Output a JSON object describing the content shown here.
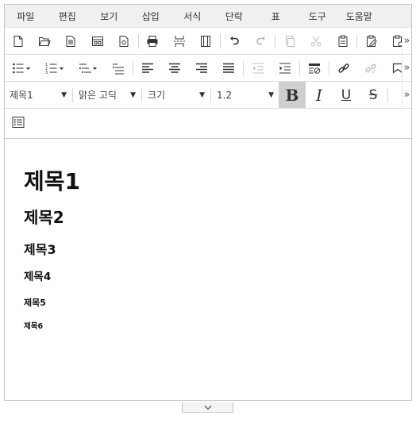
{
  "menubar": {
    "items": [
      "파일",
      "편집",
      "보기",
      "삽입",
      "서식",
      "단락",
      "표",
      "도구",
      "도움말"
    ]
  },
  "toolbar1": {
    "icons": [
      "new-document-icon",
      "open-folder-icon",
      "document-icon",
      "template-icon",
      "document-settings-icon",
      "print-icon",
      "page-break-icon",
      "fit-page-icon",
      "undo-icon",
      "redo-icon",
      "copy-icon",
      "cut-icon",
      "paste-icon",
      "paste-format-icon",
      "paste-special-icon"
    ],
    "more": "»"
  },
  "toolbar2": {
    "icons": [
      "bullet-list-icon",
      "numbered-list-icon",
      "multilevel-list-icon",
      "outline-list-icon",
      "align-left-icon",
      "align-center-icon",
      "align-right-icon",
      "align-justify-icon",
      "decrease-indent-icon",
      "increase-indent-icon",
      "clear-format-icon",
      "link-icon",
      "unlink-icon",
      "bookmark-icon"
    ],
    "more": "»"
  },
  "toolbar3": {
    "style_select": "제목1",
    "font_select": "맑은 고딕",
    "size_select": "크기",
    "line_height_select": "1.2",
    "bold_label": "B",
    "italic_label": "I",
    "underline_label": "U",
    "strike_label": "S",
    "more": "»",
    "bold_active": true
  },
  "toolbar4": {
    "icons": [
      "outline-view-icon"
    ]
  },
  "document": {
    "headings": [
      "제목1",
      "제목2",
      "제목3",
      "제목4",
      "제목5",
      "제목6"
    ]
  },
  "colors": {
    "menubar_bg": "#f0f0f0",
    "active_button_bg": "#cfcfcf",
    "border": "#c5c5c5"
  }
}
